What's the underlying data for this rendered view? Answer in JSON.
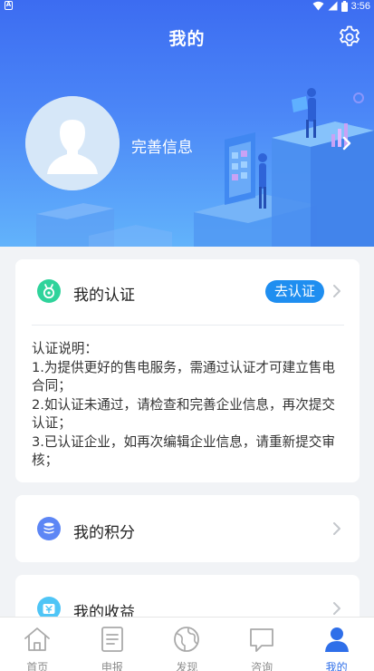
{
  "status_bar": {
    "time": "3:56"
  },
  "header": {
    "title": "我的"
  },
  "profile": {
    "complete_info_label": "完善信息"
  },
  "certification": {
    "label": "我的认证",
    "action_label": "去认证",
    "description_title": "认证说明：",
    "description_lines": [
      "1.为提供更好的售电服务，需通过认证才可建立售电合同；",
      "2.如认证未通过，请检查和完善企业信息，再次提交认证；",
      "3.已认证企业，如再次编辑企业信息，请重新提交审核；"
    ]
  },
  "points": {
    "label": "我的积分"
  },
  "income": {
    "label": "我的收益"
  },
  "bottom_nav": {
    "active_index": 4,
    "items": [
      {
        "label": "首页",
        "icon": "home-icon"
      },
      {
        "label": "申报",
        "icon": "declare-icon"
      },
      {
        "label": "发现",
        "icon": "discover-globe-icon"
      },
      {
        "label": "咨询",
        "icon": "consult-chat-icon"
      },
      {
        "label": "我的",
        "icon": "profile-icon"
      }
    ]
  },
  "colors": {
    "header_top": "#3c6cf1",
    "header_bottom": "#62b3fb",
    "accent": "#1f8ef0",
    "nav_active": "#2f6fe9",
    "nav_inactive": "#8c8c8c",
    "page_background": "#f1f3f6"
  }
}
